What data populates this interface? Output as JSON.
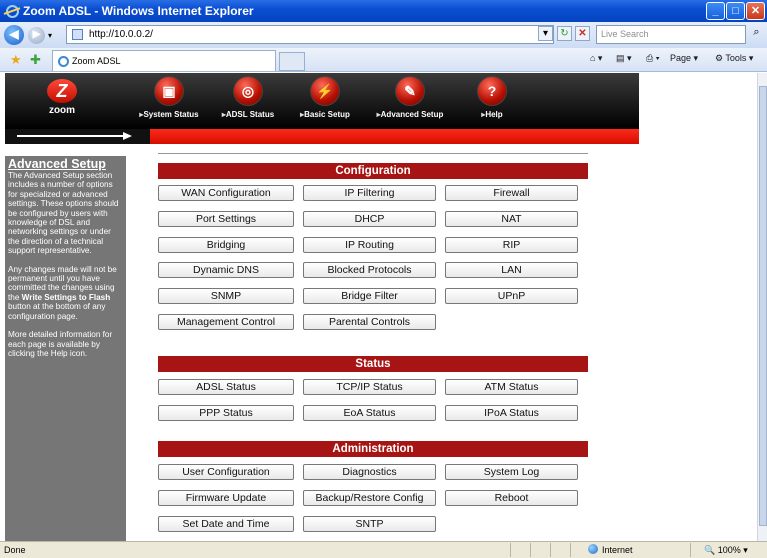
{
  "window": {
    "title": "Zoom ADSL - Windows Internet Explorer",
    "minimize": "_",
    "maximize": "□",
    "close": "✕"
  },
  "browser": {
    "address": "http://10.0.0.2/",
    "search_placeholder": "Live Search",
    "tab_title": "Zoom ADSL",
    "page_menu": "Page",
    "tools_menu": "Tools"
  },
  "icons": {
    "back": "back-arrow-icon",
    "forward": "forward-arrow-icon",
    "refresh": "refresh-icon",
    "stop": "stop-icon",
    "search": "search-icon",
    "home": "home-icon",
    "feeds": "feeds-icon",
    "print": "print-icon",
    "favorites": "favorites-star-icon"
  },
  "banner": {
    "logo_text": "zoom",
    "nav": [
      {
        "label": "System Status"
      },
      {
        "label": "ADSL Status"
      },
      {
        "label": "Basic Setup"
      },
      {
        "label": "Advanced Setup"
      },
      {
        "label": "Help"
      }
    ]
  },
  "sidebar": {
    "title": "Advanced Setup",
    "para1": "The Advanced Setup section includes a number of options for specialized or advanced settings. These options should be configured by users with knowledge of DSL and networking settings or under the direction of a technical support representative.",
    "para2_a": "Any changes made will not be permanent until you have committed the changes using the ",
    "para2_b": "Write Settings to Flash",
    "para2_c": " button at the bottom of any configuration page.",
    "para3": "More detailed information for each page is available by clicking the Help icon."
  },
  "sections": {
    "configuration": {
      "title": "Configuration",
      "buttons": [
        "WAN Configuration",
        "IP Filtering",
        "Firewall",
        "Port Settings",
        "DHCP",
        "NAT",
        "Bridging",
        "IP Routing",
        "RIP",
        "Dynamic DNS",
        "Blocked Protocols",
        "LAN",
        "SNMP",
        "Bridge Filter",
        "UPnP",
        "Management Control",
        "Parental Controls"
      ]
    },
    "status": {
      "title": "Status",
      "buttons": [
        "ADSL Status",
        "TCP/IP Status",
        "ATM Status",
        "PPP Status",
        "EoA Status",
        "IPoA Status"
      ]
    },
    "administration": {
      "title": "Administration",
      "buttons": [
        "User Configuration",
        "Diagnostics",
        "System Log",
        "Firmware Update",
        "Backup/Restore Config",
        "Reboot",
        "Set Date and Time",
        "SNTP"
      ]
    }
  },
  "statusbar": {
    "text": "Done",
    "zone": "Internet",
    "zoom": "100%"
  },
  "colors": {
    "accent_red": "#a71414",
    "banner_black": "#111111",
    "sidebar_gray": "#767676",
    "ie_blue": "#0a4fd3"
  }
}
